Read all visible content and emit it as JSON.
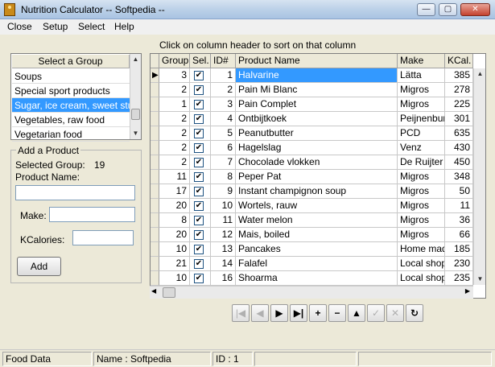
{
  "window": {
    "title": "Nutrition Calculator -- Softpedia --"
  },
  "menu": [
    "Close",
    "Setup",
    "Select",
    "Help"
  ],
  "hint": "Click on column header to sort on that column",
  "groups": {
    "header": "Select a Group",
    "items": [
      "Soups",
      "Special sport products",
      "Sugar, ice cream, sweet stuff",
      "Vegetables, raw food",
      "Vegetarian food"
    ],
    "selected_index": 2
  },
  "add_product": {
    "legend": "Add a Product",
    "selected_group_label": "Selected Group:",
    "selected_group_value": "19",
    "product_name_label": "Product Name:",
    "product_name_value": "",
    "make_label": "Make:",
    "make_value": "",
    "kcal_label": "KCalories:",
    "kcal_value": "",
    "add_button": "Add"
  },
  "grid": {
    "columns": [
      "Group",
      "Sel.",
      "ID#",
      "Product Name",
      "Make",
      "KCal."
    ],
    "rows": [
      [
        "3",
        true,
        "1",
        "Halvarine",
        "Lätta",
        "385"
      ],
      [
        "2",
        true,
        "2",
        "Pain Mi Blanc",
        "Migros",
        "278"
      ],
      [
        "1",
        true,
        "3",
        "Pain Complet",
        "Migros",
        "225"
      ],
      [
        "2",
        true,
        "4",
        "Ontbijtkoek",
        "Peijnenburg",
        "301"
      ],
      [
        "2",
        true,
        "5",
        "Peanutbutter",
        "PCD",
        "635"
      ],
      [
        "2",
        true,
        "6",
        "Hagelslag",
        "Venz",
        "430"
      ],
      [
        "2",
        true,
        "7",
        "Chocolade vlokken",
        "De Ruijter",
        "450"
      ],
      [
        "11",
        true,
        "8",
        "Peper Pat",
        "Migros",
        "348"
      ],
      [
        "17",
        true,
        "9",
        "Instant champignon soup",
        "Migros",
        "50"
      ],
      [
        "20",
        true,
        "10",
        "Wortels, rauw",
        "Migros",
        "11"
      ],
      [
        "8",
        true,
        "11",
        "Water melon",
        "Migros",
        "36"
      ],
      [
        "20",
        true,
        "12",
        "Mais, boiled",
        "Migros",
        "66"
      ],
      [
        "10",
        true,
        "13",
        "Pancakes",
        "Home made",
        "185"
      ],
      [
        "21",
        true,
        "14",
        "Falafel",
        "Local shop",
        "230"
      ],
      [
        "10",
        true,
        "16",
        "Shoarma",
        "Local shop",
        "235"
      ]
    ],
    "current_row": 0
  },
  "navigator": [
    {
      "name": "first-record-button",
      "glyph": "|◀",
      "enabled": false
    },
    {
      "name": "prior-record-button",
      "glyph": "◀",
      "enabled": false
    },
    {
      "name": "next-record-button",
      "glyph": "▶",
      "enabled": true
    },
    {
      "name": "last-record-button",
      "glyph": "▶|",
      "enabled": true
    },
    {
      "name": "insert-record-button",
      "glyph": "+",
      "enabled": true
    },
    {
      "name": "delete-record-button",
      "glyph": "−",
      "enabled": true
    },
    {
      "name": "edit-record-button",
      "glyph": "▲",
      "enabled": true
    },
    {
      "name": "post-edit-button",
      "glyph": "✓",
      "enabled": false
    },
    {
      "name": "cancel-edit-button",
      "glyph": "✕",
      "enabled": false
    },
    {
      "name": "refresh-button",
      "glyph": "↻",
      "enabled": true
    }
  ],
  "status": [
    "Food Data",
    "Name : Softpedia",
    "ID : 1",
    "",
    ""
  ]
}
